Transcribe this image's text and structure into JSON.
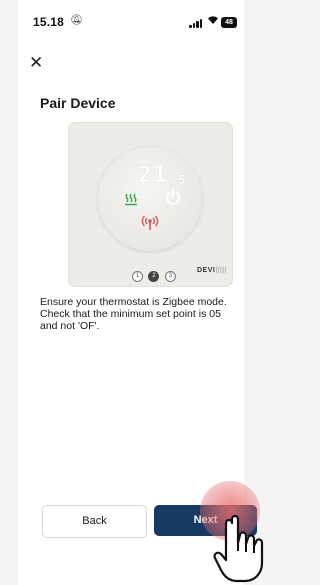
{
  "status_bar": {
    "time": "15.18",
    "battery_level": "48",
    "icons": [
      "bell-off-icon",
      "signal-icon",
      "wifi-icon",
      "battery-icon"
    ]
  },
  "header": {
    "close_icon": "close-icon",
    "title": "Pair Device"
  },
  "device": {
    "display_temperature_main": "21",
    "display_temperature_decimal": ".5",
    "steps": [
      "1",
      "2",
      "3"
    ],
    "active_step": 2,
    "brand": "DEVI",
    "icons": [
      "heating-icon",
      "power-icon",
      "antenna-icon"
    ],
    "colors": {
      "heating": "#3aa84a",
      "antenna": "#e0505a"
    }
  },
  "instruction": "Ensure your thermostat is Zigbee mode. Check that the minimum set point is 05 and not 'OF'.",
  "buttons": {
    "back_label": "Back",
    "next_label": "Next"
  },
  "colors": {
    "primary": "#173a63",
    "background": "#ffffff"
  }
}
